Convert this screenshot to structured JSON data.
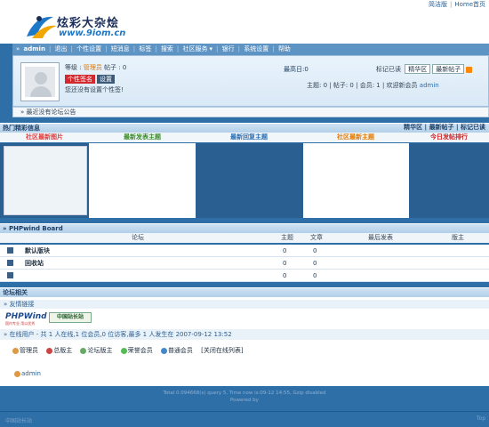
{
  "topbar": {
    "links": [
      "简洁版",
      "Home首页"
    ]
  },
  "logo": {
    "title": "炫彩大杂烩",
    "url": "www.9iom.cn"
  },
  "nav": {
    "items": [
      "admin",
      "退出",
      "个性设置",
      "短消息",
      "标签",
      "搜索",
      "社区服务",
      "银行",
      "系统设置",
      "帮助"
    ]
  },
  "user": {
    "level_label": "等级 :",
    "level_value": "管理员",
    "posts_label": "帖子 :",
    "posts_value": "0",
    "tag_sign": "个性签名",
    "tag_settings": "设置",
    "no_sign": "您还没有设置个性签!",
    "today_max": "最高日:0",
    "mark_label": "标记已读",
    "btn_elite": "精华区",
    "btn_new": "最新帖子",
    "stats_text": "主题: 0  |  帖子: 0  |  会员: 1  |  欢迎新会员",
    "new_member": "admin"
  },
  "notice": "最近没有论坛公告",
  "hot": {
    "title": "热门精彩信息",
    "tabs": [
      "精华区",
      "最新帖子",
      "标记已读"
    ],
    "columns": [
      {
        "label": "社区最新图片",
        "color": "#e03a3a"
      },
      {
        "label": "最新发表主题",
        "color": "#3a8a2a"
      },
      {
        "label": "最新回复主题",
        "color": "#2a6cb0"
      },
      {
        "label": "社区最新主题",
        "color": "#e07800"
      },
      {
        "label": "今日发帖排行",
        "color": "#d02020"
      }
    ]
  },
  "board": {
    "title": "PHPwind Board",
    "headers": [
      "论坛",
      "主题",
      "文章",
      "最后发表",
      "版主"
    ],
    "rows": [
      {
        "name": "默认版块",
        "topics": "0",
        "posts": "0"
      },
      {
        "name": "回收站",
        "topics": "0",
        "posts": "0"
      },
      {
        "name": "",
        "topics": "0",
        "posts": "0"
      }
    ]
  },
  "related": {
    "title": "论坛相关",
    "links_title": "友情链接",
    "phpwind": "PHPWind",
    "phpwind_sub": "国内专业 用以优秀",
    "cn_badge": "中国站长站",
    "online_text": "在线用户 - 共 1 人在线,1 位会员,0 位访客,最多 1 人发生在 2007-09-12 13:52",
    "legend": [
      "管理员",
      "总版主",
      "论坛版主",
      "荣誉会员",
      "普通会员"
    ],
    "close_list": "[关闭在线列表]",
    "online_user": "admin"
  },
  "footer": {
    "line1": "Total 0.094668(s) query 5, Time now is:09-12 14:55, Gzip disabled",
    "line2": "Powered by"
  },
  "bottombar": {
    "left": "中国站长站",
    "right": "Top"
  }
}
